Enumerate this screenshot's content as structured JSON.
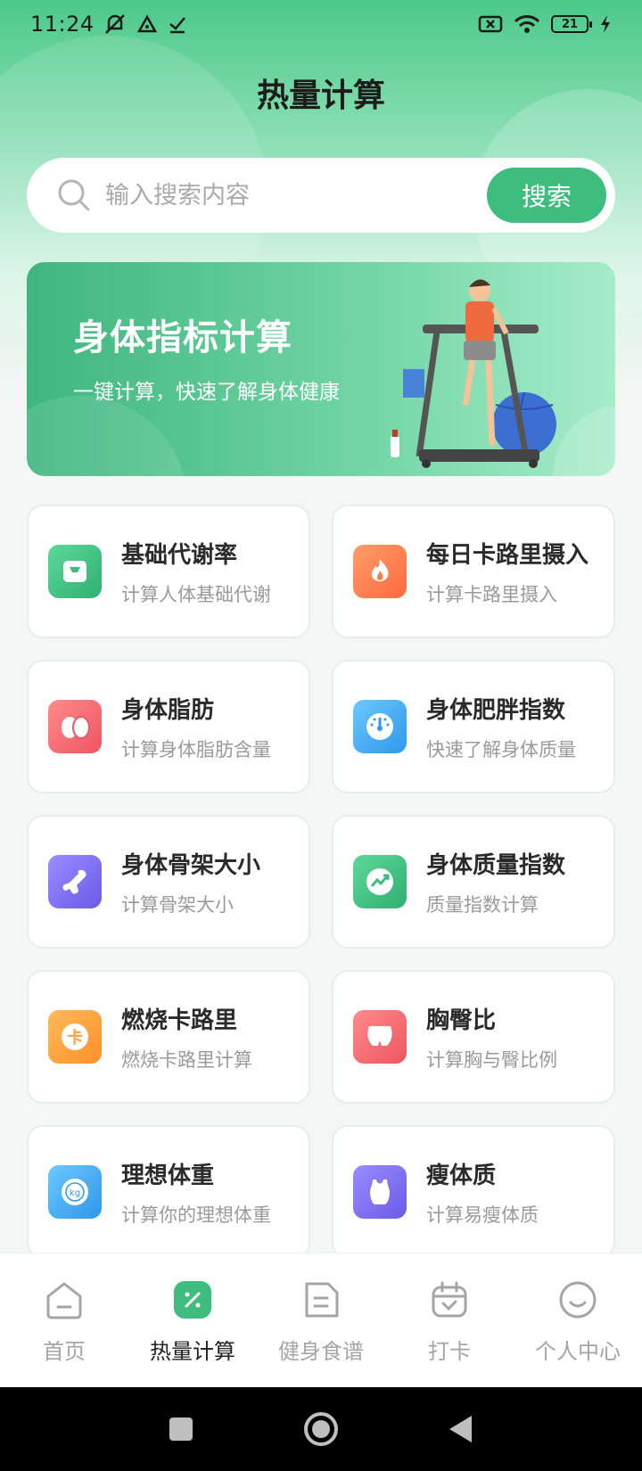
{
  "status": {
    "time": "11:24",
    "battery": "21"
  },
  "header": {
    "title": "热量计算"
  },
  "search": {
    "placeholder": "输入搜索内容",
    "button_label": "搜索"
  },
  "banner": {
    "title": "身体指标计算",
    "subtitle": "一键计算，快速了解身体健康"
  },
  "cards": [
    {
      "title": "基础代谢率",
      "subtitle": "计算人体基础代谢",
      "icon": "scale-icon",
      "color": "#3ebd7f"
    },
    {
      "title": "每日卡路里摄入",
      "subtitle": "计算卡路里摄入",
      "icon": "flame-icon",
      "color": "#ff7a4a"
    },
    {
      "title": "身体脂肪",
      "subtitle": "计算身体脂肪含量",
      "icon": "fat-icon",
      "color": "#f26068"
    },
    {
      "title": "身体肥胖指数",
      "subtitle": "快速了解身体质量",
      "icon": "gauge-icon",
      "color": "#39a6f0"
    },
    {
      "title": "身体骨架大小",
      "subtitle": "计算骨架大小",
      "icon": "bone-icon",
      "color": "#7b6cf0"
    },
    {
      "title": "身体质量指数",
      "subtitle": "质量指数计算",
      "icon": "trend-icon",
      "color": "#3ebd7f"
    },
    {
      "title": "燃烧卡路里",
      "subtitle": "燃烧卡路里计算",
      "icon": "card-icon",
      "color": "#ff9f3a"
    },
    {
      "title": "胸臀比",
      "subtitle": "计算胸与臀比例",
      "icon": "hip-icon",
      "color": "#f26068"
    },
    {
      "title": "理想体重",
      "subtitle": "计算你的理想体重",
      "icon": "weight-icon",
      "color": "#39a6f0"
    },
    {
      "title": "瘦体质",
      "subtitle": "计算易瘦体质",
      "icon": "vest-icon",
      "color": "#7b6cf0"
    }
  ],
  "tabbar": [
    {
      "label": "首页",
      "icon": "home-icon",
      "active": false
    },
    {
      "label": "热量计算",
      "icon": "calc-icon",
      "active": true
    },
    {
      "label": "健身食谱",
      "icon": "recipe-icon",
      "active": false
    },
    {
      "label": "打卡",
      "icon": "calendar-icon",
      "active": false
    },
    {
      "label": "个人中心",
      "icon": "smile-icon",
      "active": false
    }
  ],
  "colors": {
    "accent": "#3ebd7f"
  }
}
